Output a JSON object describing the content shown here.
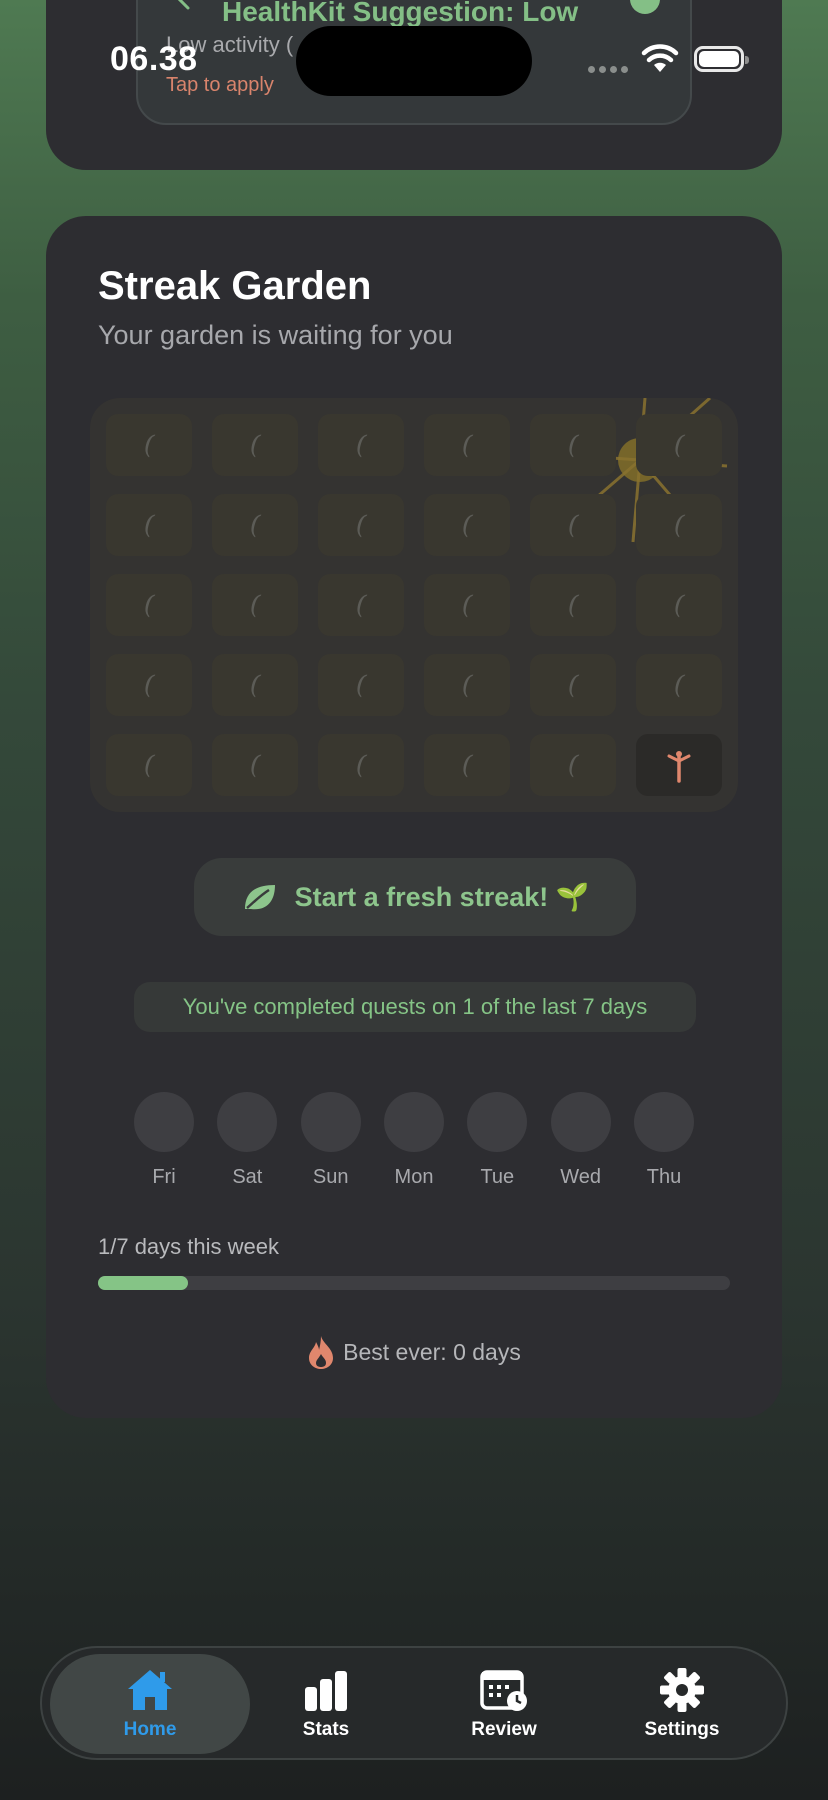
{
  "status_bar": {
    "time": "06.38"
  },
  "suggestion": {
    "title": "HealthKit Suggestion: Low",
    "subtitle": "Low activity (",
    "action": "Tap to apply"
  },
  "streak_card": {
    "title": "Streak Garden",
    "subtitle": "Your garden is waiting for you",
    "garden": {
      "columns": 6,
      "rows": 5,
      "sprouted_cells": 1
    },
    "fresh_button_label": "Start a fresh streak! 🌱",
    "quest_summary": "You've completed quests on 1 of the last 7 days",
    "days": [
      {
        "label": "Fri"
      },
      {
        "label": "Sat"
      },
      {
        "label": "Sun"
      },
      {
        "label": "Mon"
      },
      {
        "label": "Tue"
      },
      {
        "label": "Wed"
      },
      {
        "label": "Thu"
      }
    ],
    "week_progress_label": "1/7 days this week",
    "week_progress_fraction": 0.143,
    "best_ever": "Best ever: 0 days"
  },
  "tabbar": {
    "items": [
      {
        "label": "Home",
        "icon": "house-icon",
        "active": true
      },
      {
        "label": "Stats",
        "icon": "bar-chart-icon",
        "active": false
      },
      {
        "label": "Review",
        "icon": "calendar-clock-icon",
        "active": false
      },
      {
        "label": "Settings",
        "icon": "gear-icon",
        "active": false
      }
    ]
  },
  "colors": {
    "accent_green": "#85c486",
    "tab_active_blue": "#2f9bea",
    "card_bg": "#2d2d31",
    "flame": "#e0876d"
  }
}
